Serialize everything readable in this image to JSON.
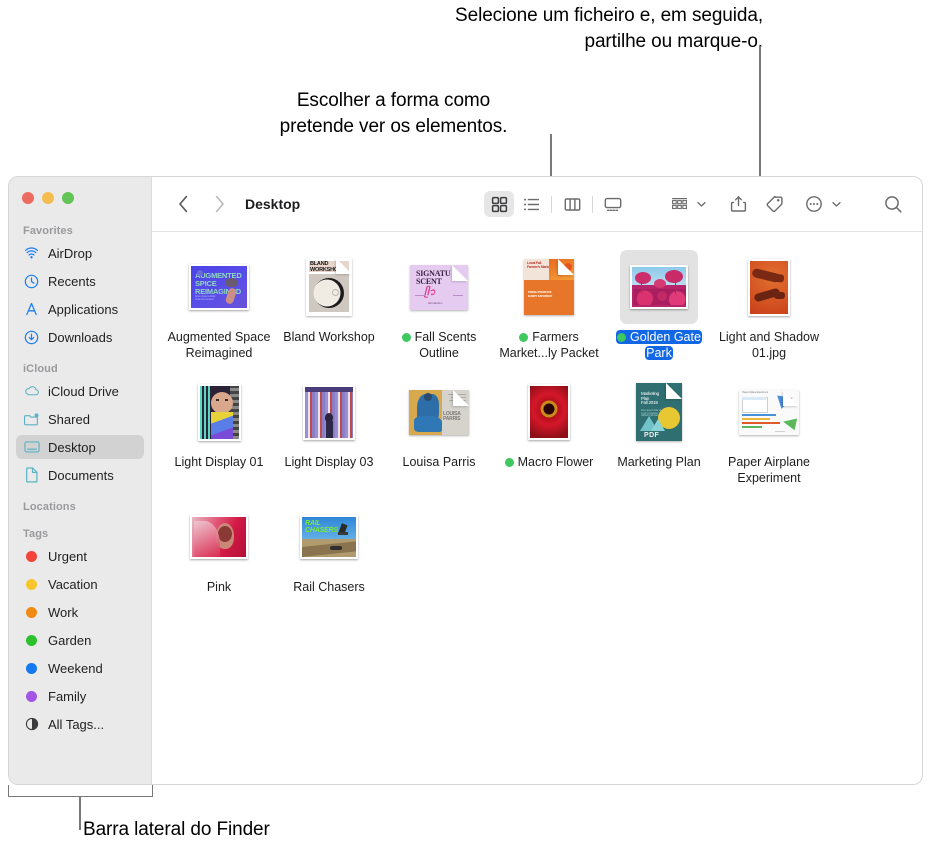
{
  "callouts": {
    "top_right": "Selecione um ficheiro e, em seguida,\npartilhe ou marque-o.",
    "left": "Escolher a forma como\npretende ver os elementos.",
    "bottom": "Barra lateral do Finder"
  },
  "window": {
    "title": "Desktop",
    "traffic_lights": [
      "close-red",
      "minimize-yellow",
      "zoom-green"
    ]
  },
  "toolbar": {
    "back": "back-chevron",
    "forward": "forward-chevron",
    "views": [
      {
        "name": "icon-view",
        "label": "Icon View",
        "active": true
      },
      {
        "name": "list-view",
        "label": "List View",
        "active": false
      },
      {
        "name": "column-view",
        "label": "Column View",
        "active": false
      },
      {
        "name": "gallery-view",
        "label": "Gallery View",
        "active": false
      }
    ],
    "group_by": "Group By",
    "share": "Share",
    "tag": "Tags",
    "more": "More",
    "search": "Search"
  },
  "sidebar": {
    "sections": [
      {
        "title": "Favorites",
        "items": [
          {
            "label": "AirDrop",
            "icon": "airdrop-icon",
            "color": "#1a7ef5",
            "selected": false
          },
          {
            "label": "Recents",
            "icon": "clock-icon",
            "color": "#1a7ef5",
            "selected": false
          },
          {
            "label": "Applications",
            "icon": "applications-icon",
            "color": "#1a7ef5",
            "selected": false
          },
          {
            "label": "Downloads",
            "icon": "downloads-icon",
            "color": "#1a7ef5",
            "selected": false
          }
        ]
      },
      {
        "title": "iCloud",
        "items": [
          {
            "label": "iCloud Drive",
            "icon": "cloud-icon",
            "color": "#5bb3c4",
            "selected": false
          },
          {
            "label": "Shared",
            "icon": "shared-folder-icon",
            "color": "#5bb3c4",
            "selected": false
          },
          {
            "label": "Desktop",
            "icon": "desktop-icon",
            "color": "#5bb3c4",
            "selected": true
          },
          {
            "label": "Documents",
            "icon": "document-icon",
            "color": "#5bb3c4",
            "selected": false
          }
        ]
      },
      {
        "title": "Locations",
        "items": []
      },
      {
        "title": "Tags",
        "items": [
          {
            "label": "Urgent",
            "icon": "tag-dot",
            "color": "#f3433b",
            "selected": false
          },
          {
            "label": "Vacation",
            "icon": "tag-dot",
            "color": "#f8c62b",
            "selected": false
          },
          {
            "label": "Work",
            "icon": "tag-dot",
            "color": "#ef8b13",
            "selected": false
          },
          {
            "label": "Garden",
            "icon": "tag-dot",
            "color": "#2cc12c",
            "selected": false
          },
          {
            "label": "Weekend",
            "icon": "tag-dot",
            "color": "#1479f0",
            "selected": false
          },
          {
            "label": "Family",
            "icon": "tag-dot",
            "color": "#a455e8",
            "selected": false
          },
          {
            "label": "All Tags...",
            "icon": "all-tags-icon",
            "color": "#6e6e73",
            "selected": false
          }
        ]
      }
    ]
  },
  "files": [
    {
      "name": "Augmented\nSpace Reimagined",
      "tag": null,
      "selected": false,
      "kind": "poster-blue"
    },
    {
      "name": "Bland Workshop",
      "tag": null,
      "selected": false,
      "kind": "doc-bland"
    },
    {
      "name": "Fall Scents\nOutline",
      "tag": "#3fc85d",
      "selected": false,
      "kind": "doc-scents"
    },
    {
      "name": "Farmers\nMarket...ly Packet",
      "tag": "#3fc85d",
      "selected": false,
      "kind": "doc-farmers"
    },
    {
      "name": "Golden Gate\nPark",
      "tag": "#3fc85d",
      "selected": true,
      "kind": "photo-flowers"
    },
    {
      "name": "Light and Shadow\n01.jpg",
      "tag": null,
      "selected": false,
      "kind": "photo-shadow"
    },
    {
      "name": "Light Display 01",
      "tag": null,
      "selected": false,
      "kind": "photo-portrait"
    },
    {
      "name": "Light Display 03",
      "tag": null,
      "selected": false,
      "kind": "photo-stripes"
    },
    {
      "name": "Louisa Parris",
      "tag": null,
      "selected": false,
      "kind": "doc-louisa"
    },
    {
      "name": "Macro Flower",
      "tag": "#3fc85d",
      "selected": false,
      "kind": "photo-macro"
    },
    {
      "name": "Marketing Plan",
      "tag": null,
      "selected": false,
      "kind": "doc-pdf"
    },
    {
      "name": "Paper Airplane\nExperiment",
      "tag": null,
      "selected": false,
      "kind": "doc-airplane"
    },
    {
      "name": "Pink",
      "tag": null,
      "selected": false,
      "kind": "photo-pink"
    },
    {
      "name": "Rail Chasers",
      "tag": null,
      "selected": false,
      "kind": "photo-rail"
    }
  ]
}
